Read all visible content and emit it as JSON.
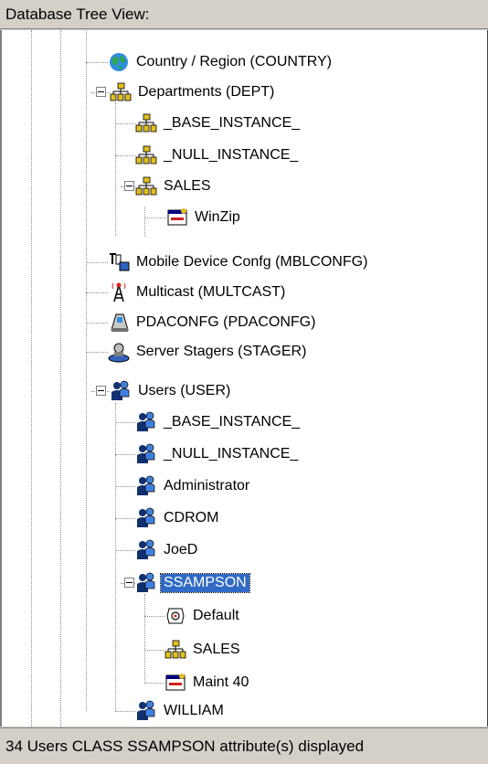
{
  "header": {
    "title": "Database Tree View:"
  },
  "tree": {
    "items": [
      {
        "label": "Country / Region (COUNTRY)",
        "icon": "globe-icon"
      },
      {
        "label": "Departments (DEPT)",
        "icon": "org-chart-icon",
        "expanded": true
      },
      {
        "label": "_BASE_INSTANCE_",
        "icon": "org-chart-icon"
      },
      {
        "label": "_NULL_INSTANCE_",
        "icon": "org-chart-icon"
      },
      {
        "label": "SALES",
        "icon": "org-chart-icon",
        "expanded": true
      },
      {
        "label": "WinZip",
        "icon": "application-icon"
      },
      {
        "label": "Mobile Device Confg (MBLCONFG)",
        "icon": "mobile-device-icon"
      },
      {
        "label": "Multicast (MULTCAST)",
        "icon": "antenna-icon"
      },
      {
        "label": "PDACONFG (PDACONFG)",
        "icon": "pda-icon"
      },
      {
        "label": "Server Stagers (STAGER)",
        "icon": "server-stager-icon"
      },
      {
        "label": "Users (USER)",
        "icon": "users-icon",
        "expanded": true
      },
      {
        "label": "_BASE_INSTANCE_",
        "icon": "users-icon"
      },
      {
        "label": "_NULL_INSTANCE_",
        "icon": "users-icon"
      },
      {
        "label": "Administrator",
        "icon": "users-icon"
      },
      {
        "label": "CDROM",
        "icon": "users-icon"
      },
      {
        "label": "JoeD",
        "icon": "users-icon"
      },
      {
        "label": "SSAMPSON",
        "icon": "users-icon",
        "expanded": true,
        "selected": true
      },
      {
        "label": "Default",
        "icon": "policy-icon"
      },
      {
        "label": "SALES",
        "icon": "org-chart-icon"
      },
      {
        "label": "Maint 40",
        "icon": "application-icon"
      },
      {
        "label": "WILLIAM",
        "icon": "users-icon"
      }
    ]
  },
  "status": {
    "text": "34 Users CLASS SSAMPSON attribute(s) displayed"
  },
  "colors": {
    "selection": "#316ac5",
    "chrome": "#d4d0c8"
  }
}
